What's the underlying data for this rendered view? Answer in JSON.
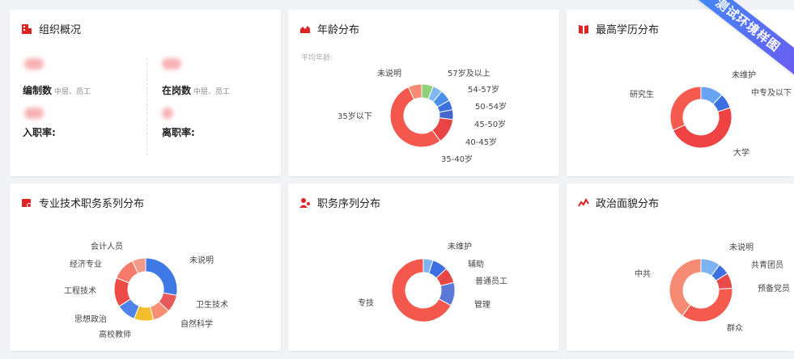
{
  "ribbon": "测试环境样图",
  "org": {
    "title": "组织概况",
    "staffing_label": "编制数",
    "staffing_sub": "中层、员工",
    "onduty_label": "在岗数",
    "onduty_sub": "中层、员工",
    "entry_label": "入职率:",
    "leave_label": "离职率:"
  },
  "age": {
    "title": "年龄分布",
    "avg_label": "平均年龄:",
    "labels": [
      "未说明",
      "57岁及以上",
      "54-57岁",
      "50-54岁",
      "45-50岁",
      "40-45岁",
      "35-40岁",
      "35岁以下"
    ]
  },
  "edu": {
    "title": "最高学历分布",
    "labels": [
      "未维护",
      "中专及以下",
      "研究生",
      "大学"
    ]
  },
  "tech": {
    "title": "专业技术职务系列分布",
    "labels": [
      "会计人员",
      "未说明",
      "经济专业",
      "工程技术",
      "卫生技术",
      "自然科学",
      "思想政治",
      "高校教师"
    ]
  },
  "duty": {
    "title": "职务序列分布",
    "labels": [
      "未维护",
      "辅助",
      "普通员工",
      "管理",
      "专技"
    ]
  },
  "politic": {
    "title": "政治面貌分布",
    "labels": [
      "未说明",
      "共青团员",
      "中共",
      "预备党员",
      "群众"
    ]
  },
  "colors": {
    "brand_red": "#e02424",
    "ribbon_blue": "#3f8cf7"
  },
  "chart_data": [
    {
      "type": "pie",
      "title": "年龄分布",
      "categories": [
        "57岁及以上",
        "54-57岁",
        "50-54岁",
        "45-50岁",
        "40-45岁",
        "35-40岁",
        "35岁以下",
        "未说明"
      ],
      "values": [
        6,
        5,
        6,
        5,
        5,
        13,
        53,
        7
      ],
      "colors": [
        "#8fd17a",
        "#7db8f5",
        "#4a8fee",
        "#3a6fdd",
        "#4466cc",
        "#ea4545",
        "#f4574b",
        "#f58b75"
      ]
    },
    {
      "type": "pie",
      "title": "最高学历分布",
      "categories": [
        "未维护",
        "中专及以下",
        "大学",
        "研究生"
      ],
      "values": [
        12,
        8,
        48,
        32
      ],
      "colors": [
        "#6aa3f2",
        "#3b6fe0",
        "#ef4343",
        "#f45a4d"
      ]
    },
    {
      "type": "pie",
      "title": "专业技术职务系列分布",
      "categories": [
        "未说明",
        "卫生技术",
        "自然科学",
        "高校教师",
        "思想政治",
        "工程技术",
        "经济专业",
        "会计人员"
      ],
      "values": [
        28,
        9,
        9,
        10,
        10,
        15,
        12,
        7
      ],
      "colors": [
        "#3f79e6",
        "#e55a5a",
        "#f79072",
        "#f5be2c",
        "#4e83ea",
        "#ef4b46",
        "#f47b6c",
        "#f29a88"
      ]
    },
    {
      "type": "pie",
      "title": "职务序列分布",
      "categories": [
        "未维护",
        "辅助",
        "普通员工",
        "管理",
        "专技"
      ],
      "values": [
        5,
        8,
        8,
        12,
        67
      ],
      "colors": [
        "#7eb3f3",
        "#3c70e0",
        "#ea4545",
        "#5a78d8",
        "#f4574b"
      ]
    },
    {
      "type": "pie",
      "title": "政治面貌分布",
      "categories": [
        "未说明",
        "共青团员",
        "预备党员",
        "群众",
        "中共"
      ],
      "values": [
        10,
        6,
        8,
        36,
        40
      ],
      "colors": [
        "#7eb3f3",
        "#3c70e0",
        "#e64a4a",
        "#f45a4d",
        "#f48b72"
      ]
    }
  ]
}
